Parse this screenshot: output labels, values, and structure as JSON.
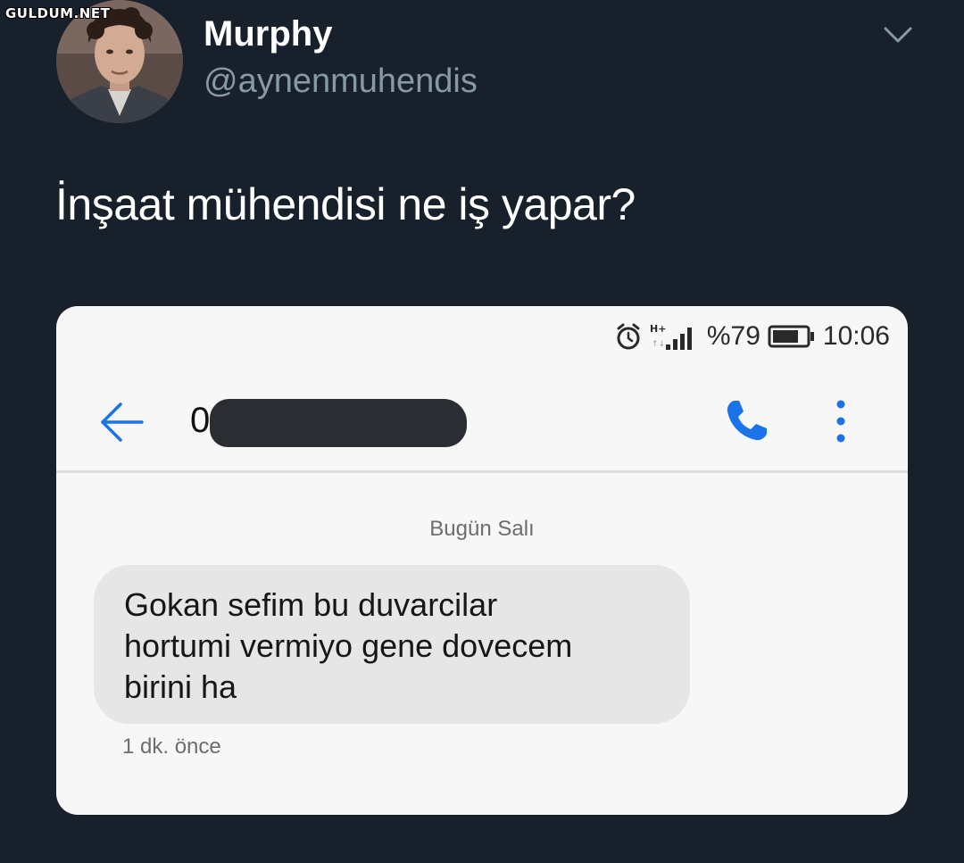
{
  "watermark": "GULDUM.NET",
  "tweet": {
    "display_name": "Murphy",
    "handle": "@aynenmuhendis",
    "text": "İnşaat mühendisi ne iş yapar?"
  },
  "icons": {
    "menu": "chevron-down-icon",
    "alarm": "alarm-clock-icon",
    "network": "hplus-network-icon",
    "signal": "signal-bars-icon",
    "battery": "battery-icon",
    "back": "back-arrow-icon",
    "call": "phone-icon",
    "more": "more-vertical-icon"
  },
  "screenshot": {
    "status_bar": {
      "network_type": "H+",
      "battery_percent": "%79",
      "battery_level": 0.79,
      "time": "10:06"
    },
    "conversation": {
      "contact_visible": "0",
      "date_label": "Bugün Salı",
      "message_lines": [
        "Gokan sefim bu duvarcilar",
        "hortumi vermiyo gene dovecem",
        "birini ha"
      ],
      "message_time": "1 dk. önce"
    }
  },
  "colors": {
    "background": "#17202b",
    "handle": "#8899a6",
    "accent_blue": "#1a73e8"
  }
}
